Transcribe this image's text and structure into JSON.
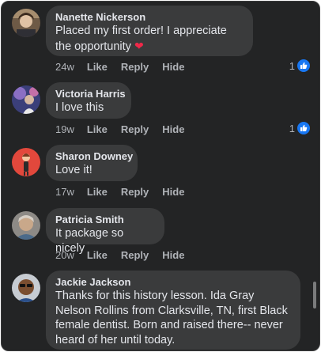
{
  "comments": [
    {
      "author": "Nanette Nickerson",
      "text": "Placed my first order! I appreciate the opportunity",
      "emoji": "❤️",
      "time": "24w",
      "like": "Like",
      "reply": "Reply",
      "hide": "Hide",
      "reactions": "1"
    },
    {
      "author": "Victoria Harris",
      "text": "I love this",
      "time": "19w",
      "like": "Like",
      "reply": "Reply",
      "hide": "Hide",
      "reactions": "1"
    },
    {
      "author": "Sharon Downey",
      "text": "Love it!",
      "time": "17w",
      "like": "Like",
      "reply": "Reply",
      "hide": "Hide"
    },
    {
      "author": "Patricia Smith",
      "text": "It package so nicely",
      "time": "20w",
      "like": "Like",
      "reply": "Reply",
      "hide": "Hide"
    },
    {
      "author": "Jackie Jackson",
      "text": "Thanks for this history lesson. Ida Gray Nelson Rollins from Clarksville, TN, first Black female dentist. Born and raised there-- never heard of her until today."
    }
  ],
  "colors": {
    "background": "#232425",
    "bubble": "#3a3b3c",
    "text": "#e4e6eb",
    "secondary": "#b0b3b8",
    "like_blue": "#1877f2",
    "heart": "#f02849"
  },
  "icons": {
    "reaction": "thumbs-up-icon",
    "emoji": "red-heart-icon"
  }
}
